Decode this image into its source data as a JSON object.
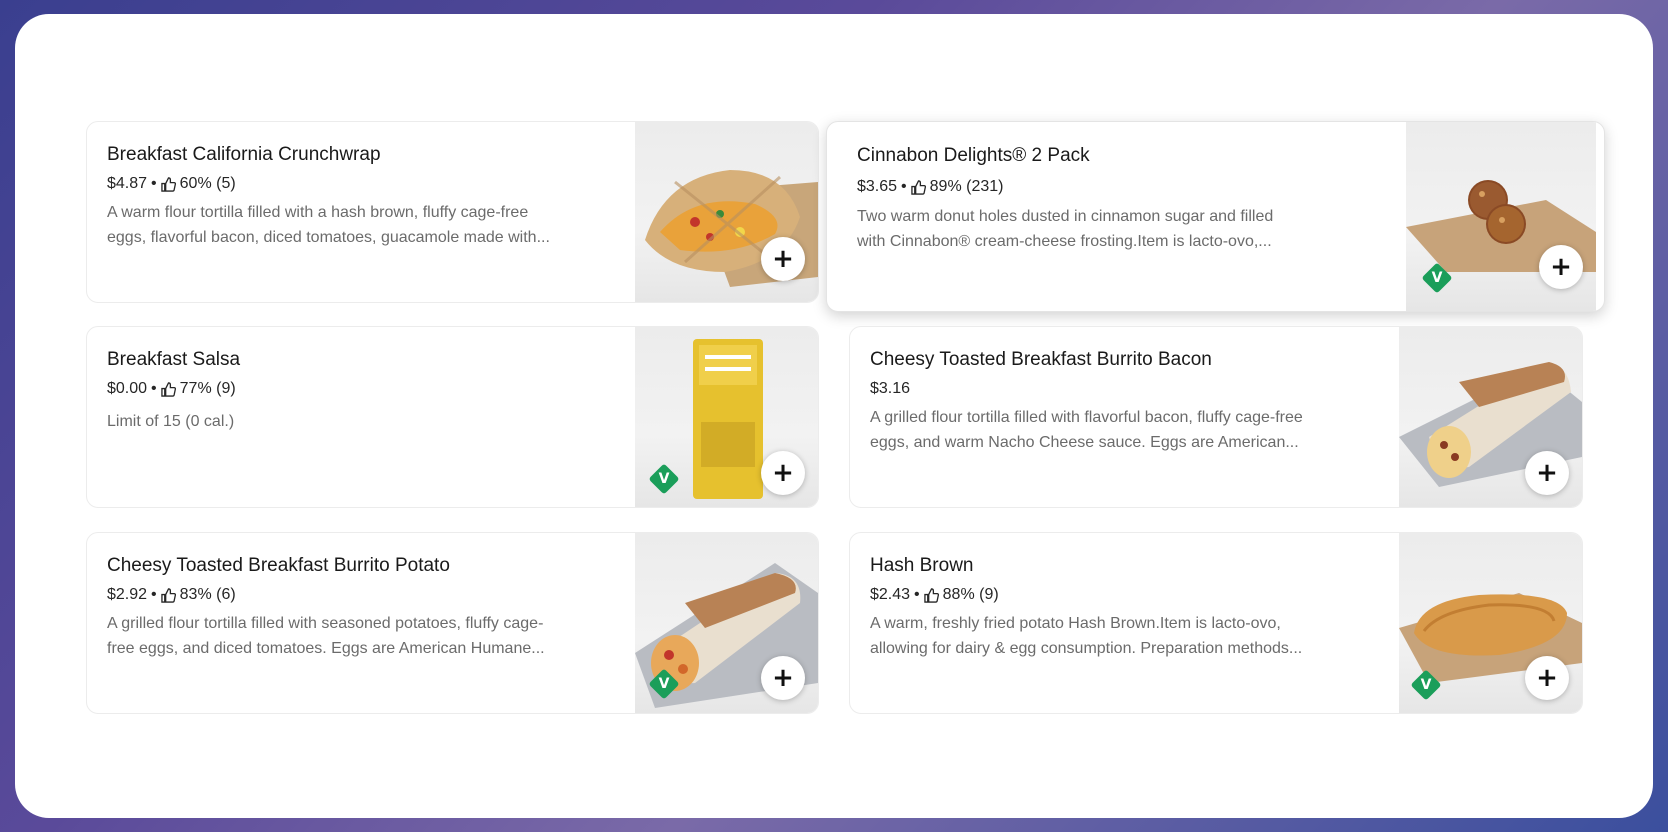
{
  "items": [
    {
      "title": "Breakfast California Crunchwrap",
      "price": "$4.87",
      "rating": "60% (5)",
      "desc1": "A warm flour tortilla filled with a hash brown, fluffy cage-free",
      "desc2": "eggs, flavorful bacon, diced tomatoes, guacamole made with...",
      "add": "+"
    },
    {
      "title": "Cinnabon Delights® 2 Pack",
      "price": "$3.65",
      "rating": "89% (231)",
      "desc1": "Two warm donut holes dusted in cinnamon sugar and filled",
      "desc2": "with Cinnabon® cream-cheese frosting.Item is lacto-ovo,...",
      "add": "+",
      "veg": "V"
    },
    {
      "title": "Breakfast Salsa",
      "price": "$0.00",
      "rating": "77% (9)",
      "desc1": "Limit of 15 (0 cal.)",
      "add": "+",
      "veg": "V"
    },
    {
      "title": "Cheesy Toasted Breakfast Burrito Bacon",
      "price": "$3.16",
      "desc1": "A grilled flour tortilla filled with flavorful bacon, fluffy cage-free",
      "desc2": "eggs, and warm Nacho Cheese sauce. Eggs are American...",
      "add": "+"
    },
    {
      "title": "Cheesy Toasted Breakfast Burrito Potato",
      "price": "$2.92",
      "rating": "83% (6)",
      "desc1": "A grilled flour tortilla filled with seasoned potatoes, fluffy cage-",
      "desc2": "free eggs, and diced tomatoes. Eggs are American Humane...",
      "add": "+",
      "veg": "V"
    },
    {
      "title": "Hash Brown",
      "price": "$2.43",
      "rating": "88% (9)",
      "desc1": "A warm, freshly fried potato Hash Brown.Item is lacto-ovo,",
      "desc2": "allowing for dairy & egg consumption. Preparation methods...",
      "add": "+",
      "veg": "V"
    }
  ],
  "separator": "•",
  "colors": {
    "veg_badge": "#1b9e5a",
    "title": "#1a1a1a",
    "desc": "#6b6b6b"
  },
  "icons": {
    "rating": "thumbs-up-icon",
    "add": "plus-icon",
    "vegetarian": "vegetarian-badge-icon"
  }
}
